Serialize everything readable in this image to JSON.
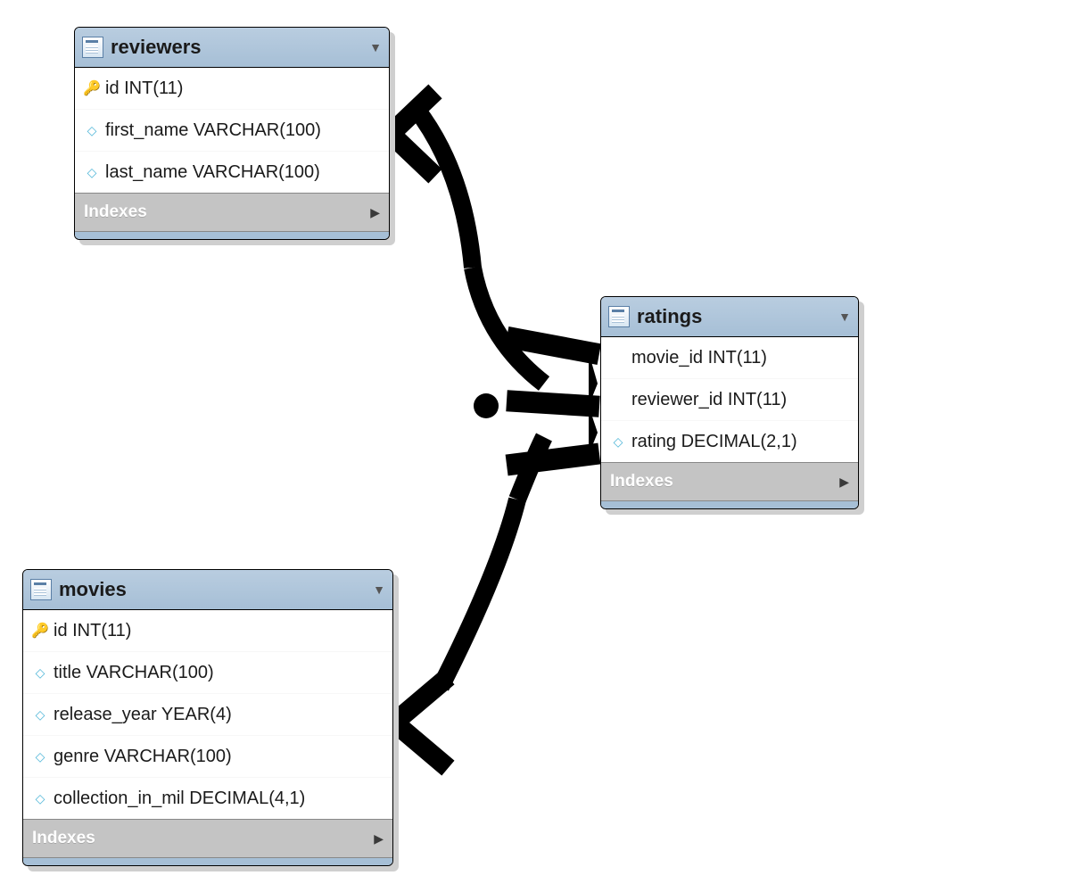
{
  "tables": {
    "reviewers": {
      "title": "reviewers",
      "indexes_label": "Indexes",
      "columns": [
        {
          "icon": "key",
          "text": "id INT(11)"
        },
        {
          "icon": "diamond",
          "text": "first_name VARCHAR(100)"
        },
        {
          "icon": "diamond",
          "text": "last_name VARCHAR(100)"
        }
      ]
    },
    "movies": {
      "title": "movies",
      "indexes_label": "Indexes",
      "columns": [
        {
          "icon": "key",
          "text": "id INT(11)"
        },
        {
          "icon": "diamond",
          "text": "title VARCHAR(100)"
        },
        {
          "icon": "diamond",
          "text": "release_year YEAR(4)"
        },
        {
          "icon": "diamond",
          "text": "genre VARCHAR(100)"
        },
        {
          "icon": "diamond",
          "text": "collection_in_mil DECIMAL(4,1)"
        }
      ]
    },
    "ratings": {
      "title": "ratings",
      "indexes_label": "Indexes",
      "columns": [
        {
          "icon": "none",
          "text": "movie_id INT(11)"
        },
        {
          "icon": "none",
          "text": "reviewer_id INT(11)"
        },
        {
          "icon": "diamond",
          "text": "rating DECIMAL(2,1)"
        }
      ]
    }
  },
  "relationships": [
    {
      "from_table": "reviewers",
      "from_column": "id",
      "to_table": "ratings",
      "to_column": "reviewer_id",
      "type": "one-to-many"
    },
    {
      "from_table": "movies",
      "from_column": "id",
      "to_table": "ratings",
      "to_column": "movie_id",
      "type": "one-to-many"
    }
  ]
}
